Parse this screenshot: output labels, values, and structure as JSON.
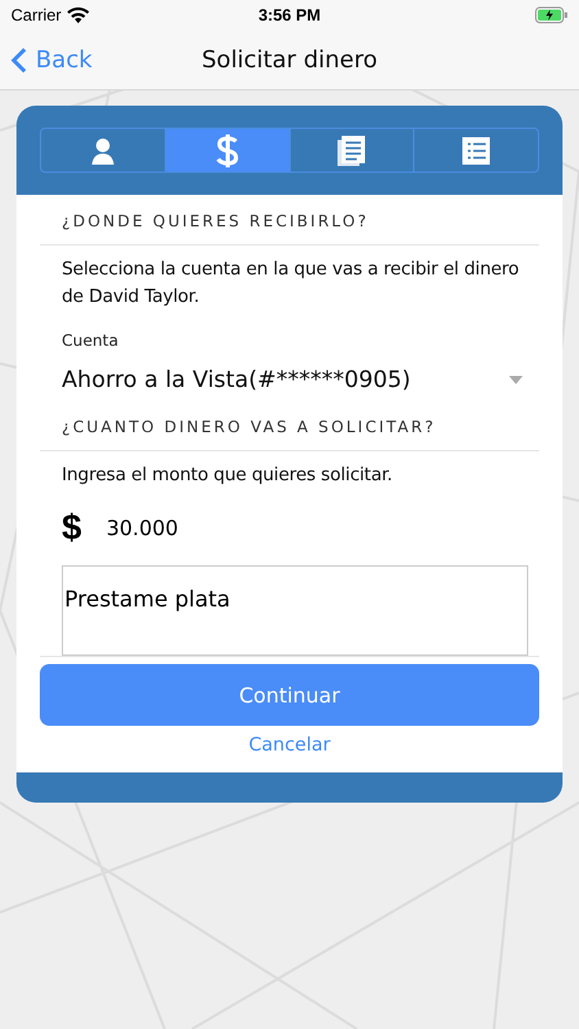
{
  "status_bar": {
    "carrier": "Carrier",
    "time": "3:56 PM"
  },
  "nav": {
    "back": "Back",
    "title": "Solicitar dinero"
  },
  "tabs": [
    {
      "kind": "person",
      "selected": false
    },
    {
      "kind": "dollar",
      "selected": true
    },
    {
      "kind": "document",
      "selected": false
    },
    {
      "kind": "list",
      "selected": false
    }
  ],
  "section_1": {
    "heading": "¿DONDE QUIERES RECIBIRLO?",
    "text": "Selecciona la cuenta en la que vas a recibir el dinero de David Taylor.",
    "account_label": "Cuenta",
    "account_value": "Ahorro a la Vista(#******0905)"
  },
  "section_2": {
    "heading": "¿CUANTO DINERO VAS A SOLICITAR?",
    "text": "Ingresa el monto que quieres solicitar.",
    "currency": "$",
    "amount": "30.000",
    "message": "Prestame plata"
  },
  "buttons": {
    "continue": "Continuar",
    "cancel": "Cancelar"
  }
}
